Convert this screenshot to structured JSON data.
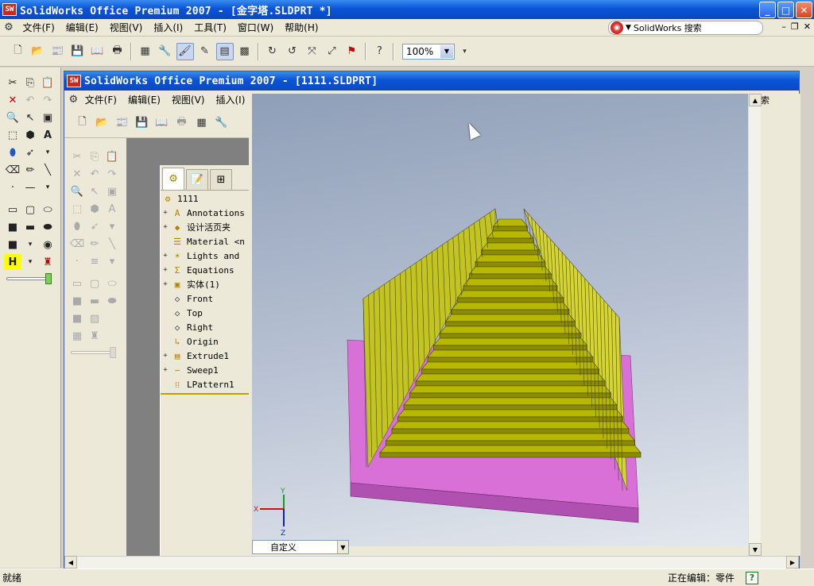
{
  "app": {
    "title": "SolidWorks Office Premium 2007 - [金字塔.SLDPRT *]",
    "logo_text": "SW"
  },
  "menu": {
    "items": [
      "文件(F)",
      "编辑(E)",
      "视图(V)",
      "插入(I)",
      "工具(T)",
      "窗口(W)",
      "帮助(H)"
    ]
  },
  "search": {
    "label": "SolidWorks 搜索"
  },
  "toolbar": {
    "zoom": "100%"
  },
  "inner_window": {
    "title": "SolidWorks Office Premium 2007 - [1111.SLDPRT]",
    "menu_items": [
      "文件(F)",
      "编辑(E)",
      "视图(V)",
      "插入(I)"
    ],
    "behind_text": "索"
  },
  "feature_tree": {
    "root": "1111",
    "items": [
      {
        "label": "Annotations",
        "expand": true,
        "icon": "annotation-icon"
      },
      {
        "label": "设计活页夹",
        "expand": true,
        "icon": "binder-icon"
      },
      {
        "label": "Material <n",
        "expand": false,
        "icon": "material-icon"
      },
      {
        "label": "Lights and",
        "expand": true,
        "icon": "lights-icon"
      },
      {
        "label": "Equations",
        "expand": true,
        "icon": "equations-icon"
      },
      {
        "label": "实体(1)",
        "expand": true,
        "icon": "solid-body-icon"
      },
      {
        "label": "Front",
        "expand": false,
        "icon": "plane-icon"
      },
      {
        "label": "Top",
        "expand": false,
        "icon": "plane-icon"
      },
      {
        "label": "Right",
        "expand": false,
        "icon": "plane-icon"
      },
      {
        "label": "Origin",
        "expand": false,
        "icon": "origin-icon"
      },
      {
        "label": "Extrude1",
        "expand": true,
        "icon": "extrude-icon"
      },
      {
        "label": "Sweep1",
        "expand": true,
        "icon": "sweep-icon"
      },
      {
        "label": "LPattern1",
        "expand": false,
        "icon": "pattern-icon"
      }
    ]
  },
  "viewport": {
    "view_orientation": "自定义",
    "axis_labels": {
      "x": "X",
      "y": "Y",
      "z": "Z"
    },
    "model_colors": {
      "steps": "#b8b800",
      "base": "#d870d8",
      "walls": "#c4c41e"
    }
  },
  "status": {
    "left": "就绪",
    "right": "正在编辑：零件",
    "help": "?"
  }
}
